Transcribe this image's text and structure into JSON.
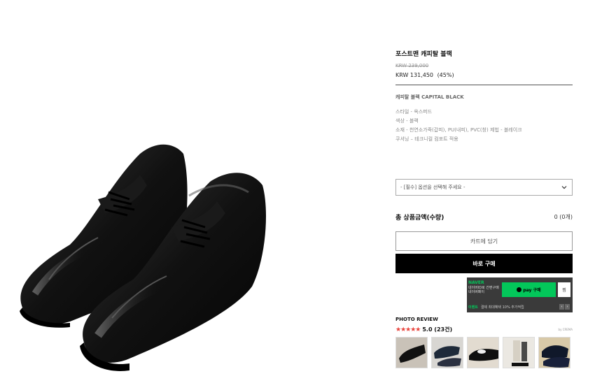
{
  "product": {
    "name": "포스트맨 캐피탈 블랙",
    "original_price": "KRW 239,000",
    "sale_price": "KRW 131,450",
    "discount": "(45%)"
  },
  "description": {
    "title": "캐피탈 블랙 CAPITAL BLACK",
    "lines": [
      "스타일 - 옥스퍼드",
      "색상 - 블랙",
      "소재 - 천연소가죽(갑피), PU(내피), PVC(창) 제법 - 블레이크",
      "쿠셔닝 – 테크니컬 컴포트 적용"
    ]
  },
  "option": {
    "placeholder": "- [필수] 옵션을 선택해 주세요 -"
  },
  "total": {
    "label": "총 상품금액(수량)",
    "value": "0 (0개)"
  },
  "buttons": {
    "cart": "카트에 담기",
    "buy_now": "바로 구매"
  },
  "naver_pay": {
    "brand": "NAVER",
    "sub": "네이버ID로 간편구매 네이버페이",
    "buy": "pay 구매",
    "wish": "찜",
    "event_label": "이벤트",
    "event_text": "결제 최대혜택 10% 추가적립",
    "colors": {
      "green": "#03c75a",
      "panel": "#3a3a3a"
    }
  },
  "reviews": {
    "title": "PHOTO REVIEW",
    "stars": "★★★★★",
    "score": "5.0 (23건)",
    "powered": "by CREMA",
    "star_color": "#e8413a",
    "thumbnails": [
      "review-photo-1",
      "review-photo-2",
      "review-photo-3",
      "review-photo-4",
      "review-photo-5"
    ]
  }
}
